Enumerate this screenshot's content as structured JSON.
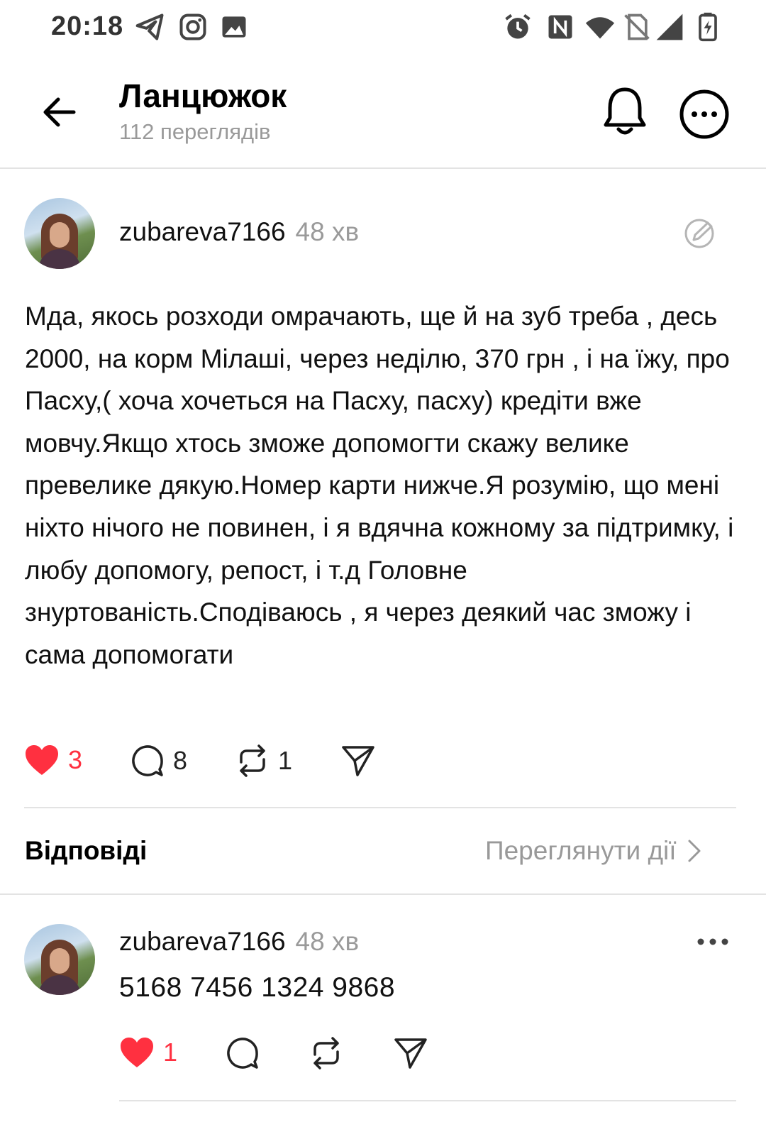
{
  "status_bar": {
    "time": "20:18",
    "left_icons": [
      "telegram-icon",
      "instagram-icon",
      "gallery-icon"
    ],
    "right_icons": [
      "alarm-icon",
      "nfc-icon",
      "wifi-icon",
      "no-sim-icon",
      "signal-icon",
      "battery-charging-icon"
    ]
  },
  "header": {
    "title": "Ланцюжок",
    "subtitle": "112 переглядів"
  },
  "post": {
    "username": "zubareva7166",
    "time": "48 хв",
    "text": "Мда, якось розходи омрачають, ще й на зуб треба , десь 2000, на корм Мілаші, через неділю, 370 грн , і на їжу, про Пасху,( хоча хочеться на Пасху, пасху) кредіти вже мовчу.Якщо хтось зможе допомогти скажу велике превелике дякую.Номер карти нижче.Я розумію, що мені ніхто нічого не повинен, і я вдячна кожному за підтримку, і любу допомогу, репост, і т.д Головне знуртованість.Сподіваюсь , я через деякий час зможу і сама допомогати",
    "likes": "3",
    "comments": "8",
    "reposts": "1"
  },
  "replies_section": {
    "title": "Відповіді",
    "view_actions": "Переглянути дії"
  },
  "reply": {
    "username": "zubareva7166",
    "time": "48 хв",
    "text": "5168 7456 1324 9868",
    "likes": "1"
  },
  "colors": {
    "like_red": "#ff3040",
    "muted_gray": "#999999",
    "divider": "#e3e3e3"
  }
}
